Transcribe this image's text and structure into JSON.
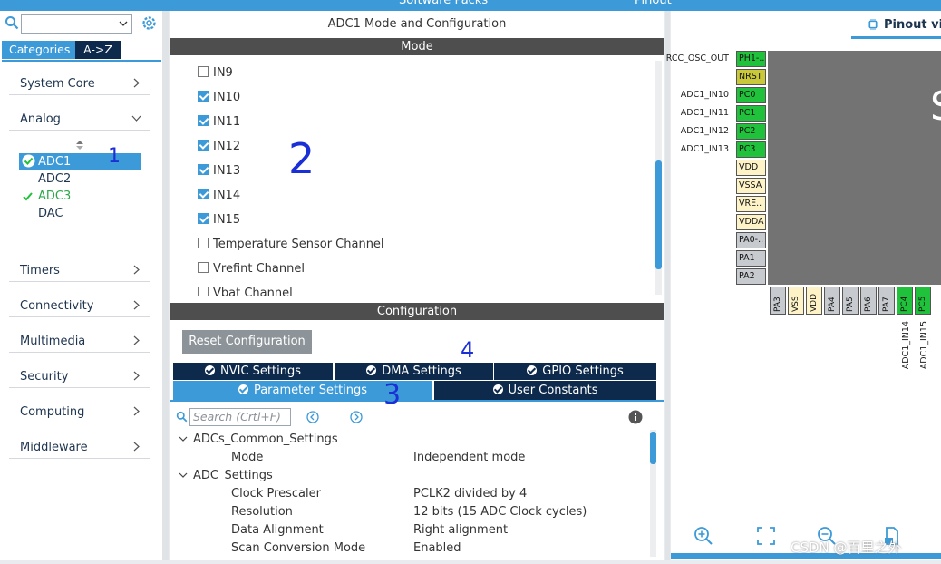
{
  "topbar": {
    "left": "Software Packs",
    "right": "Pinout"
  },
  "left": {
    "tabs": [
      "Categories",
      "A->Z"
    ],
    "categories": [
      {
        "label": "System Core",
        "state": "collapsed"
      },
      {
        "label": "Analog",
        "state": "expanded"
      },
      {
        "label": "Timers",
        "state": "collapsed"
      },
      {
        "label": "Connectivity",
        "state": "collapsed"
      },
      {
        "label": "Multimedia",
        "state": "collapsed"
      },
      {
        "label": "Security",
        "state": "collapsed"
      },
      {
        "label": "Computing",
        "state": "collapsed"
      },
      {
        "label": "Middleware",
        "state": "collapsed"
      }
    ],
    "analog_items": [
      {
        "label": "ADC1",
        "selected": true,
        "ok": true
      },
      {
        "label": "ADC2",
        "selected": false,
        "ok": false
      },
      {
        "label": "ADC3",
        "selected": false,
        "ok": true
      },
      {
        "label": "DAC",
        "selected": false,
        "ok": false
      }
    ]
  },
  "mid": {
    "title": "ADC1 Mode and Configuration",
    "mode_bar": "Mode",
    "channels": [
      {
        "label": "IN9",
        "checked": false
      },
      {
        "label": "IN10",
        "checked": true
      },
      {
        "label": "IN11",
        "checked": true
      },
      {
        "label": "IN12",
        "checked": true
      },
      {
        "label": "IN13",
        "checked": true
      },
      {
        "label": "IN14",
        "checked": true
      },
      {
        "label": "IN15",
        "checked": true
      },
      {
        "label": "Temperature Sensor Channel",
        "checked": false
      },
      {
        "label": "Vrefint Channel",
        "checked": false
      },
      {
        "label": "Vbat Channel",
        "checked": false
      }
    ],
    "config_bar": "Configuration",
    "reset": "Reset Configuration",
    "tabs_row1": [
      "NVIC Settings",
      "DMA Settings",
      "GPIO Settings"
    ],
    "tabs_row2": [
      "Parameter Settings",
      "User Constants"
    ],
    "search_placeholder": "Search (Crtl+F)",
    "params": [
      {
        "name": "ADCs_Common_Settings",
        "value": "",
        "level": 0
      },
      {
        "name": "Mode",
        "value": "Independent mode",
        "level": 1
      },
      {
        "name": "ADC_Settings",
        "value": "",
        "level": 0
      },
      {
        "name": "Clock Prescaler",
        "value": "PCLK2 divided by 4",
        "level": 1
      },
      {
        "name": "Resolution",
        "value": "12 bits (15 ADC Clock cycles)",
        "level": 1
      },
      {
        "name": "Data Alignment",
        "value": "Right alignment",
        "level": 1
      },
      {
        "name": "Scan Conversion Mode",
        "value": "Enabled",
        "level": 1
      }
    ]
  },
  "right": {
    "tab": "Pinout vie",
    "left_pins": [
      {
        "pin": "PH1-..",
        "label": "RCC_OSC_OUT",
        "color": "#1fc23a"
      },
      {
        "pin": "NRST",
        "label": "",
        "color": "#c8c83a"
      },
      {
        "pin": "PC0",
        "label": "ADC1_IN10",
        "color": "#1fc23a"
      },
      {
        "pin": "PC1",
        "label": "ADC1_IN11",
        "color": "#1fc23a"
      },
      {
        "pin": "PC2",
        "label": "ADC1_IN12",
        "color": "#1fc23a"
      },
      {
        "pin": "PC3",
        "label": "ADC1_IN13",
        "color": "#1fc23a"
      },
      {
        "pin": "VDD",
        "label": "",
        "color": "#fdf3c7"
      },
      {
        "pin": "VSSA",
        "label": "",
        "color": "#fdf3c7"
      },
      {
        "pin": "VRE..",
        "label": "",
        "color": "#fdf3c7"
      },
      {
        "pin": "VDDA",
        "label": "",
        "color": "#fdf3c7"
      },
      {
        "pin": "PA0-..",
        "label": "",
        "color": "#c7cbcf"
      },
      {
        "pin": "PA1",
        "label": "",
        "color": "#c7cbcf"
      },
      {
        "pin": "PA2",
        "label": "",
        "color": "#c7cbcf"
      }
    ],
    "bottom_pins": [
      {
        "pin": "PA3",
        "color": "#c7cbcf"
      },
      {
        "pin": "VSS",
        "color": "#fdf3c7"
      },
      {
        "pin": "VDD",
        "color": "#fdf3c7"
      },
      {
        "pin": "PA4",
        "color": "#c7cbcf"
      },
      {
        "pin": "PA5",
        "color": "#c7cbcf"
      },
      {
        "pin": "PA6",
        "color": "#c7cbcf"
      },
      {
        "pin": "PA7",
        "color": "#c7cbcf"
      },
      {
        "pin": "PC4",
        "color": "#1fc23a"
      },
      {
        "pin": "PC5",
        "color": "#1fc23a"
      }
    ],
    "bottom_labels": [
      "ADC1_IN14",
      "ADC1_IN15"
    ]
  },
  "annotations": [
    "1",
    "2",
    "3",
    "4"
  ],
  "watermark": "CSDN @百里之外",
  "colors": {
    "accent": "#3c9ad8",
    "dark": "#0d2a4c",
    "green": "#1fc23a"
  }
}
